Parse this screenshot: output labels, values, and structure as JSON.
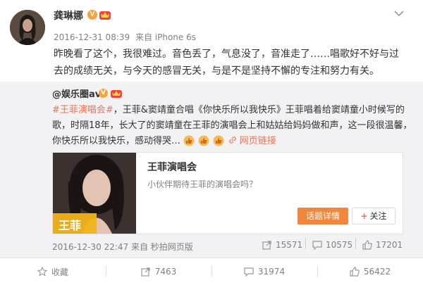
{
  "post": {
    "username": "龚琳娜",
    "timestamp": "2016-12-31 08:39",
    "source": "来自 iPhone 6s",
    "content": "昨晚看了这个，我很难过。音色丢了，气息没了，音准走了……唱歌好不好与过去的成绩无关，与今天的感冒无关，与是不是坚持不懈的专注和努力有关。"
  },
  "repost": {
    "username": "@娱乐圈avi",
    "topic_tag": "#王菲演唱会#",
    "text": "，王菲&窦靖童合唱《你快乐所以我快乐》王菲唱着给窦靖童小时候写的歌，时隔18年，长大了的窦靖童在王菲的演唱会上和姑姑给妈妈做和声，这一段很温馨，你快乐所以我快乐，感动得哭…",
    "weblink_label": "网页链接",
    "card": {
      "image_caption": "王菲",
      "title": "王菲演唱会",
      "description": "小伙伴期待王菲的演唱会吗？",
      "topic_button": "话题详情",
      "follow_button": "关注"
    },
    "timestamp": "2016-12-30 22:47",
    "source": "来自 秒拍网页版",
    "reposts": "15571",
    "comments": "10575",
    "likes": "17201"
  },
  "actions": {
    "favorite": "收藏",
    "repost": "7463",
    "comment": "31974",
    "like": "56422"
  },
  "colors": {
    "accent": "#eb7350",
    "topic_button": "#f0873c",
    "verified": "#f7a23b",
    "repost_bg": "#f2f2f5"
  }
}
